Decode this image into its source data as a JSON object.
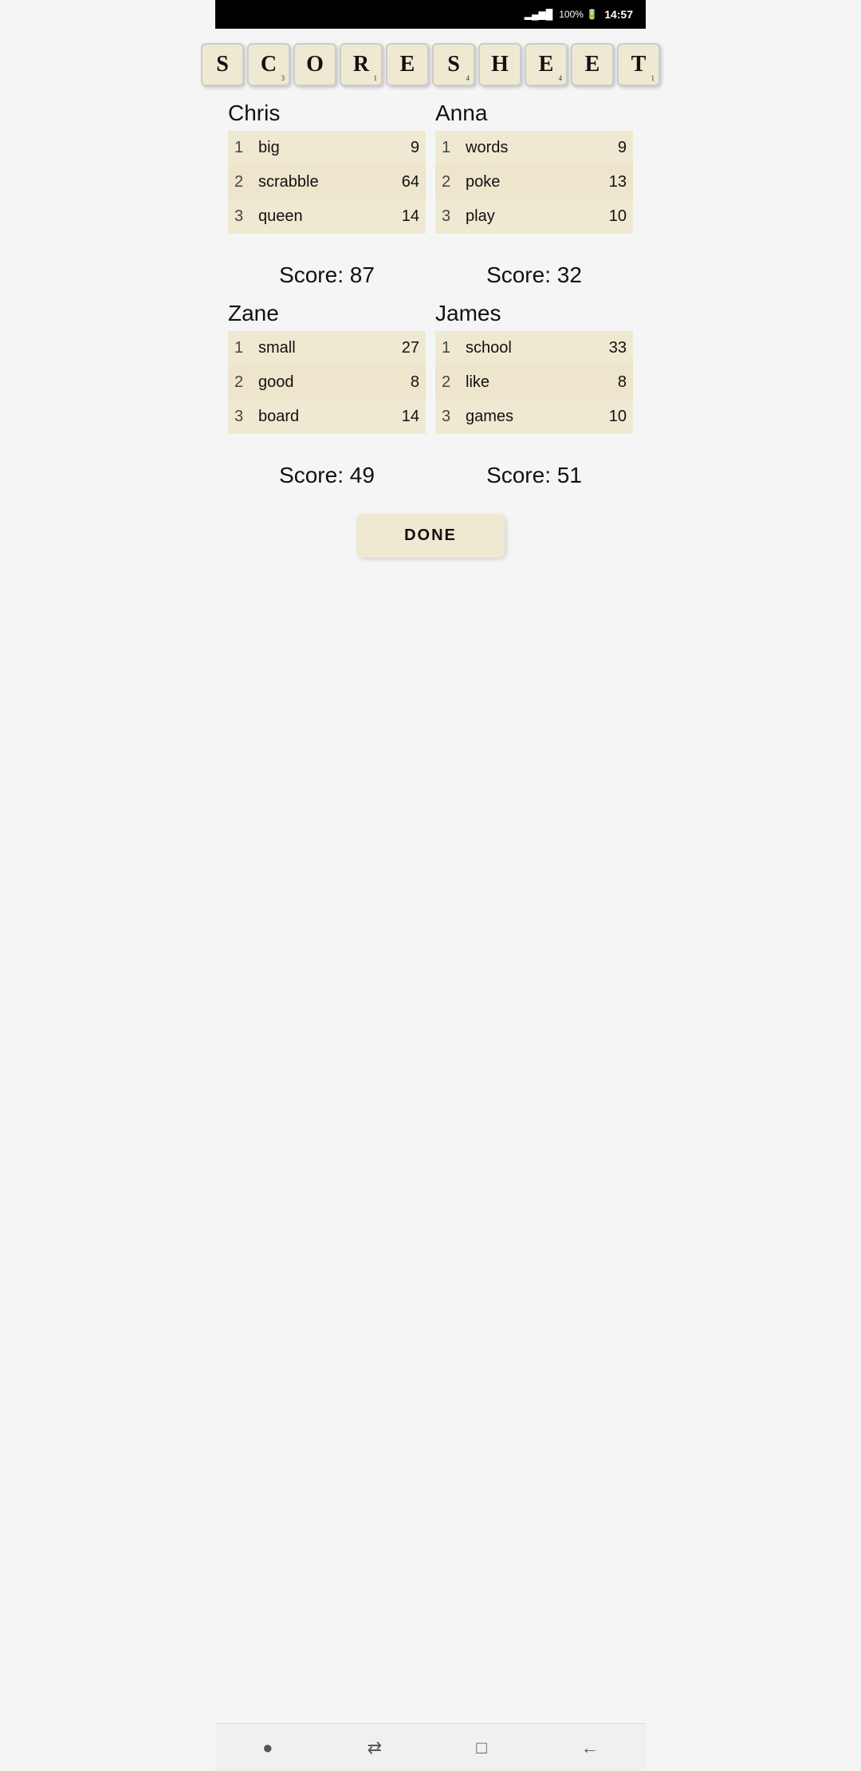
{
  "statusBar": {
    "signal": "▂▄▆█",
    "battery": "100% 🔋",
    "time": "14:57"
  },
  "title": {
    "letters": [
      {
        "char": "S",
        "num": ""
      },
      {
        "char": "C",
        "num": "3"
      },
      {
        "char": "O",
        "num": ""
      },
      {
        "char": "R",
        "num": "1"
      },
      {
        "char": "E",
        "num": ""
      },
      {
        "char": "S",
        "num": "4"
      },
      {
        "char": "H",
        "num": ""
      },
      {
        "char": "E",
        "num": "4"
      },
      {
        "char": "E",
        "num": ""
      },
      {
        "char": "T",
        "num": "1"
      }
    ]
  },
  "players": [
    {
      "id": "chris",
      "name": "Chris",
      "words": [
        {
          "num": 1,
          "word": "big",
          "score": 9
        },
        {
          "num": 2,
          "word": "scrabble",
          "score": 64
        },
        {
          "num": 3,
          "word": "queen",
          "score": 14
        }
      ],
      "total": "Score: 87"
    },
    {
      "id": "anna",
      "name": "Anna",
      "words": [
        {
          "num": 1,
          "word": "words",
          "score": 9
        },
        {
          "num": 2,
          "word": "poke",
          "score": 13
        },
        {
          "num": 3,
          "word": "play",
          "score": 10
        }
      ],
      "total": "Score: 32"
    },
    {
      "id": "zane",
      "name": "Zane",
      "words": [
        {
          "num": 1,
          "word": "small",
          "score": 27
        },
        {
          "num": 2,
          "word": "good",
          "score": 8
        },
        {
          "num": 3,
          "word": "board",
          "score": 14
        }
      ],
      "total": "Score: 49"
    },
    {
      "id": "james",
      "name": "James",
      "words": [
        {
          "num": 1,
          "word": "school",
          "score": 33
        },
        {
          "num": 2,
          "word": "like",
          "score": 8
        },
        {
          "num": 3,
          "word": "games",
          "score": 10
        }
      ],
      "total": "Score: 51"
    }
  ],
  "doneButton": "DONE",
  "nav": {
    "home": "●",
    "recent": "⇄",
    "square": "□",
    "back": "←"
  }
}
